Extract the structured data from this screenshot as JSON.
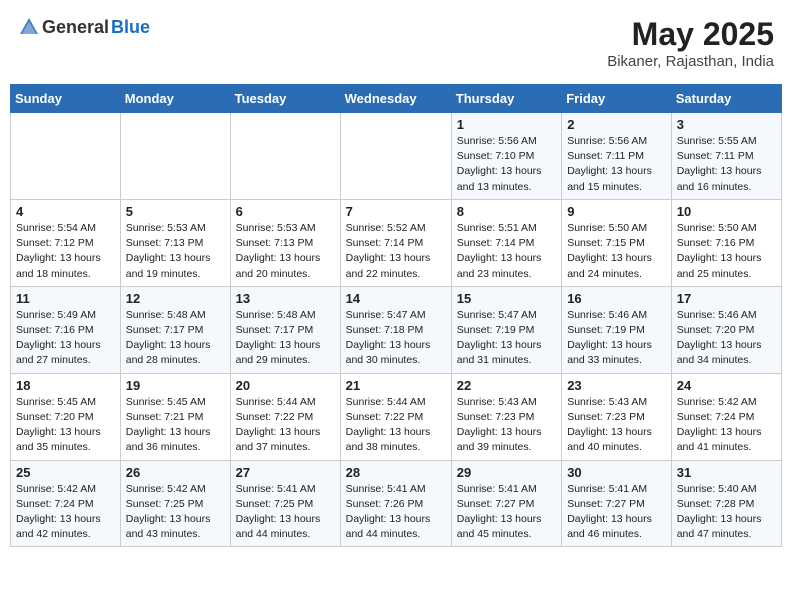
{
  "logo": {
    "general": "General",
    "blue": "Blue"
  },
  "title": {
    "month_year": "May 2025",
    "location": "Bikaner, Rajasthan, India"
  },
  "days_of_week": [
    "Sunday",
    "Monday",
    "Tuesday",
    "Wednesday",
    "Thursday",
    "Friday",
    "Saturday"
  ],
  "weeks": [
    [
      {
        "day": "",
        "info": ""
      },
      {
        "day": "",
        "info": ""
      },
      {
        "day": "",
        "info": ""
      },
      {
        "day": "",
        "info": ""
      },
      {
        "day": "1",
        "info": "Sunrise: 5:56 AM\nSunset: 7:10 PM\nDaylight: 13 hours\nand 13 minutes."
      },
      {
        "day": "2",
        "info": "Sunrise: 5:56 AM\nSunset: 7:11 PM\nDaylight: 13 hours\nand 15 minutes."
      },
      {
        "day": "3",
        "info": "Sunrise: 5:55 AM\nSunset: 7:11 PM\nDaylight: 13 hours\nand 16 minutes."
      }
    ],
    [
      {
        "day": "4",
        "info": "Sunrise: 5:54 AM\nSunset: 7:12 PM\nDaylight: 13 hours\nand 18 minutes."
      },
      {
        "day": "5",
        "info": "Sunrise: 5:53 AM\nSunset: 7:13 PM\nDaylight: 13 hours\nand 19 minutes."
      },
      {
        "day": "6",
        "info": "Sunrise: 5:53 AM\nSunset: 7:13 PM\nDaylight: 13 hours\nand 20 minutes."
      },
      {
        "day": "7",
        "info": "Sunrise: 5:52 AM\nSunset: 7:14 PM\nDaylight: 13 hours\nand 22 minutes."
      },
      {
        "day": "8",
        "info": "Sunrise: 5:51 AM\nSunset: 7:14 PM\nDaylight: 13 hours\nand 23 minutes."
      },
      {
        "day": "9",
        "info": "Sunrise: 5:50 AM\nSunset: 7:15 PM\nDaylight: 13 hours\nand 24 minutes."
      },
      {
        "day": "10",
        "info": "Sunrise: 5:50 AM\nSunset: 7:16 PM\nDaylight: 13 hours\nand 25 minutes."
      }
    ],
    [
      {
        "day": "11",
        "info": "Sunrise: 5:49 AM\nSunset: 7:16 PM\nDaylight: 13 hours\nand 27 minutes."
      },
      {
        "day": "12",
        "info": "Sunrise: 5:48 AM\nSunset: 7:17 PM\nDaylight: 13 hours\nand 28 minutes."
      },
      {
        "day": "13",
        "info": "Sunrise: 5:48 AM\nSunset: 7:17 PM\nDaylight: 13 hours\nand 29 minutes."
      },
      {
        "day": "14",
        "info": "Sunrise: 5:47 AM\nSunset: 7:18 PM\nDaylight: 13 hours\nand 30 minutes."
      },
      {
        "day": "15",
        "info": "Sunrise: 5:47 AM\nSunset: 7:19 PM\nDaylight: 13 hours\nand 31 minutes."
      },
      {
        "day": "16",
        "info": "Sunrise: 5:46 AM\nSunset: 7:19 PM\nDaylight: 13 hours\nand 33 minutes."
      },
      {
        "day": "17",
        "info": "Sunrise: 5:46 AM\nSunset: 7:20 PM\nDaylight: 13 hours\nand 34 minutes."
      }
    ],
    [
      {
        "day": "18",
        "info": "Sunrise: 5:45 AM\nSunset: 7:20 PM\nDaylight: 13 hours\nand 35 minutes."
      },
      {
        "day": "19",
        "info": "Sunrise: 5:45 AM\nSunset: 7:21 PM\nDaylight: 13 hours\nand 36 minutes."
      },
      {
        "day": "20",
        "info": "Sunrise: 5:44 AM\nSunset: 7:22 PM\nDaylight: 13 hours\nand 37 minutes."
      },
      {
        "day": "21",
        "info": "Sunrise: 5:44 AM\nSunset: 7:22 PM\nDaylight: 13 hours\nand 38 minutes."
      },
      {
        "day": "22",
        "info": "Sunrise: 5:43 AM\nSunset: 7:23 PM\nDaylight: 13 hours\nand 39 minutes."
      },
      {
        "day": "23",
        "info": "Sunrise: 5:43 AM\nSunset: 7:23 PM\nDaylight: 13 hours\nand 40 minutes."
      },
      {
        "day": "24",
        "info": "Sunrise: 5:42 AM\nSunset: 7:24 PM\nDaylight: 13 hours\nand 41 minutes."
      }
    ],
    [
      {
        "day": "25",
        "info": "Sunrise: 5:42 AM\nSunset: 7:24 PM\nDaylight: 13 hours\nand 42 minutes."
      },
      {
        "day": "26",
        "info": "Sunrise: 5:42 AM\nSunset: 7:25 PM\nDaylight: 13 hours\nand 43 minutes."
      },
      {
        "day": "27",
        "info": "Sunrise: 5:41 AM\nSunset: 7:25 PM\nDaylight: 13 hours\nand 44 minutes."
      },
      {
        "day": "28",
        "info": "Sunrise: 5:41 AM\nSunset: 7:26 PM\nDaylight: 13 hours\nand 44 minutes."
      },
      {
        "day": "29",
        "info": "Sunrise: 5:41 AM\nSunset: 7:27 PM\nDaylight: 13 hours\nand 45 minutes."
      },
      {
        "day": "30",
        "info": "Sunrise: 5:41 AM\nSunset: 7:27 PM\nDaylight: 13 hours\nand 46 minutes."
      },
      {
        "day": "31",
        "info": "Sunrise: 5:40 AM\nSunset: 7:28 PM\nDaylight: 13 hours\nand 47 minutes."
      }
    ]
  ]
}
